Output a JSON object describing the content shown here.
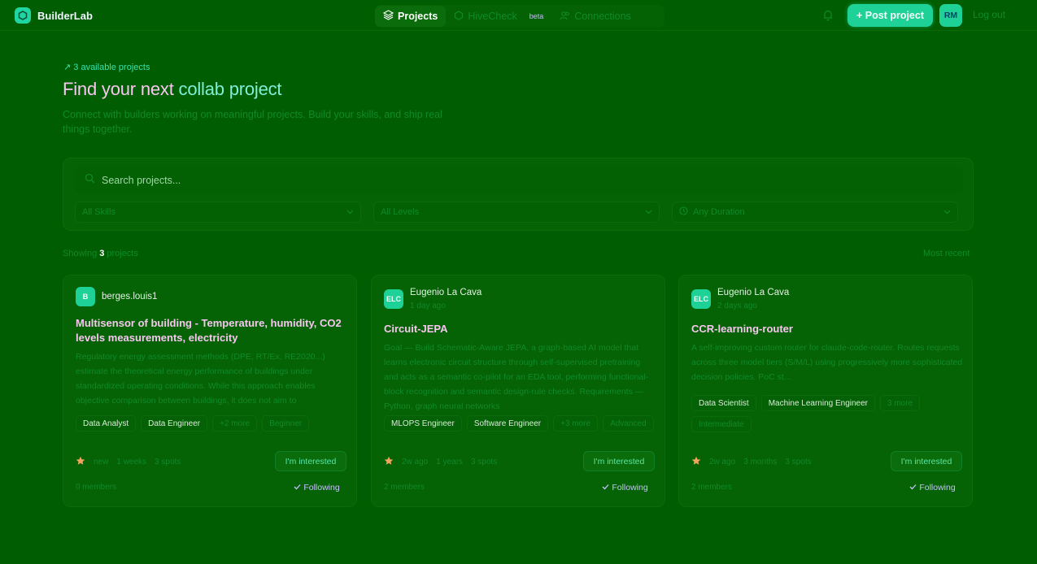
{
  "app": {
    "name": "BuilderLab"
  },
  "nav": {
    "projects": "Projects",
    "hivecheck": "HiveCheck",
    "beta": "beta",
    "connections": "Connections",
    "post_project": "+ Post project",
    "avatar_initials": "RM",
    "logout": "Log out"
  },
  "hero": {
    "kicker": "↗ 3 available projects",
    "title_prefix": "Find your next ",
    "title_accent": "collab project",
    "subtitle": "Connect with builders working on meaningful projects. Build your skills, and ship real things together."
  },
  "filters": {
    "search_placeholder": "Search projects...",
    "skills": "All Skills",
    "levels": "All Levels",
    "durations": "Any Duration"
  },
  "results": {
    "showing_prefix": "Showing",
    "count": "3",
    "showing_suffix": "projects",
    "sort": "Most recent"
  },
  "cards": [
    {
      "avatar": "B",
      "author": "berges.louis1",
      "meta": "",
      "title": "Multisensor of building - Temperature, humidity, CO2 levels measurements, electricity",
      "desc": "Regulatory energy assessment methods (DPE, RT/Ex, RE2020...) estimate the theoretical energy performance of buildings under standardized operating conditions. While this approach enables objective comparison between buildings, it does not aim to",
      "tags": [
        "Data Analyst",
        "Data Engineer"
      ],
      "tags_dim": [
        "+2 more",
        "Beginner"
      ],
      "stats": [
        "new",
        "1 weeks",
        "3 spots"
      ],
      "interest": "I'm interested",
      "members": "0 members",
      "follow": "Following"
    },
    {
      "avatar": "ELC",
      "author": "Eugenio La Cava",
      "meta": "1 day ago",
      "title": "Circuit-JEPA",
      "desc": "Goal — Build Schematic-Aware JEPA, a graph-based AI model that learns electronic circuit structure through self-supervised pretraining and acts as a semantic co-pilot for an EDA tool, performing functional-block recognition and semantic design-rule checks. Requirements — Python, graph neural networks",
      "tags": [
        "MLOPS Engineer",
        "Software Engineer"
      ],
      "tags_dim": [
        "+3 more",
        "Advanced"
      ],
      "stats": [
        "2w ago",
        "1 years",
        "3 spots"
      ],
      "interest": "I'm interested",
      "members": "2 members",
      "follow": "Following"
    },
    {
      "avatar": "ELC",
      "author": "Eugenio La Cava",
      "meta": "2 days ago",
      "title": "CCR-learning-router",
      "desc": "A self-improving custom router for claude-code-router. Routes requests across three model tiers (S/M/L) using progressively more sophisticated decision policies. PoC st...",
      "tags": [
        "Data Scientist",
        "Machine Learning Engineer"
      ],
      "tags_dim": [
        "3 more",
        "Intermediate"
      ],
      "stats": [
        "2w ago",
        "3 months",
        "3 spots"
      ],
      "interest": "I'm interested",
      "members": "2 members",
      "follow": "Following"
    }
  ]
}
